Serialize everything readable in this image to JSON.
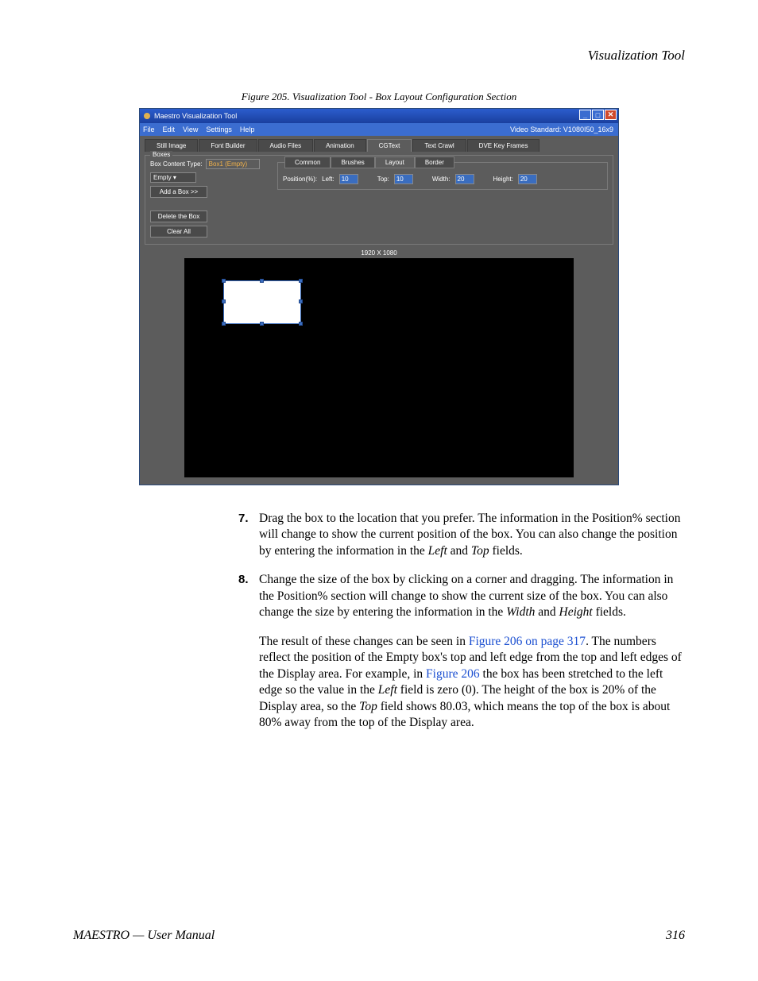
{
  "header": {
    "section_title": "Visualization Tool"
  },
  "figure": {
    "caption": "Figure 205.  Visualization Tool - Box Layout Configuration Section"
  },
  "app": {
    "title": "Maestro Visualization Tool",
    "menu": {
      "file": "File",
      "edit": "Edit",
      "view": "View",
      "settings": "Settings",
      "help": "Help"
    },
    "video_standard_label": "Video Standard: V1080I50_16x9",
    "tabs": {
      "still": "Still Image",
      "font": "Font Builder",
      "audio": "Audio Files",
      "anim": "Animation",
      "cgtext": "CGText",
      "crawl": "Text Crawl",
      "dve": "DVE Key Frames"
    },
    "boxes": {
      "legend": "Boxes",
      "content_type_label": "Box Content Type:",
      "content_type_value": "Empty",
      "box_name": "Box1 (Empty)",
      "add": "Add a Box >>",
      "delete": "Delete the Box",
      "clear": "Clear All"
    },
    "subtabs": {
      "common": "Common",
      "brushes": "Brushes",
      "layout": "Layout",
      "border": "Border"
    },
    "position": {
      "label": "Position(%):",
      "left_label": "Left:",
      "left": "10",
      "top_label": "Top:",
      "top": "10",
      "width_label": "Width:",
      "width": "20",
      "height_label": "Height:",
      "height": "20"
    },
    "canvas": {
      "dims": "1920 X 1080"
    }
  },
  "steps": {
    "s7_num": "7.",
    "s7": "Drag the box to the location that you prefer. The information in the Position% section will change to show the current position of the box. You can also change the position by entering the information in the ",
    "s7_em1": "Left",
    "s7_mid": " and ",
    "s7_em2": "Top",
    "s7_end": " fields.",
    "s8_num": "8.",
    "s8": "Change the size of the box by clicking on a corner and dragging. The information in the Position% section will change to show the current size of the box. You can also change the size by entering the information in the ",
    "s8_em1": "Width",
    "s8_mid": " and ",
    "s8_em2": "Height",
    "s8_end": " fields.",
    "p2a": "The result of these changes can be seen in ",
    "p2_link1": "Figure 206 on page 317",
    "p2b": ". The numbers reflect the position of the Empty box's top and left edge from the top and left edges of the Display area. For example, in ",
    "p2_link2": "Figure 206",
    "p2c": " the box has been stretched to the left edge so the value in the ",
    "p2_em1": "Left",
    "p2d": " field is zero (0). The height of the box is 20% of the Display area, so the ",
    "p2_em2": "Top",
    "p2e": " field shows 80.03, which means the top of the box is about 80% away from the top of the Display area."
  },
  "footer": {
    "left": "MAESTRO  —  User Manual",
    "right": "316"
  }
}
